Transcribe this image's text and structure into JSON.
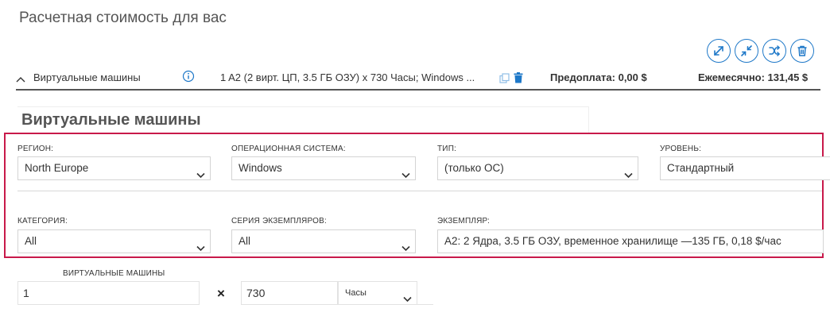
{
  "page_title": "Расчетная стоимость для вас",
  "toolbar": {
    "icons": [
      "expand-icon",
      "collapse-icon",
      "shuffle-icon",
      "trash-icon"
    ],
    "accent": "#1e78c8"
  },
  "summary": {
    "label": "Виртуальные машины",
    "description": "1 A2 (2 вирт. ЦП, 3.5 ГБ ОЗУ) x 730 Часы; Windows ...",
    "prepay": "Предоплата: 0,00 $",
    "monthly": "Ежемесячно: 131,45 $"
  },
  "section_title": "Виртуальные машины",
  "fields": {
    "region": {
      "label": "РЕГИОН:",
      "value": "North Europe"
    },
    "os": {
      "label": "ОПЕРАЦИОННАЯ СИСТЕМА:",
      "value": "Windows"
    },
    "type": {
      "label": "ТИП:",
      "value": "(только ОС)"
    },
    "tier": {
      "label": "УРОВЕНЬ:",
      "value": "Стандартный"
    },
    "category": {
      "label": "КАТЕГОРИЯ:",
      "value": "All"
    },
    "series": {
      "label": "СЕРИЯ ЭКЗЕМПЛЯРОВ:",
      "value": "All"
    },
    "instance": {
      "label": "ЭКЗЕМПЛЯР:",
      "value": "A2: 2 Ядра, 3.5 ГБ ОЗУ, временное хранилище —135 ГБ, 0,18 $/час"
    }
  },
  "quantity": {
    "label": "ВИРТУАЛЬНЫЕ МАШИНЫ",
    "count": "1",
    "times": "×",
    "hours": "730",
    "unit": "Часы"
  },
  "highlight_color": "#c8194a"
}
